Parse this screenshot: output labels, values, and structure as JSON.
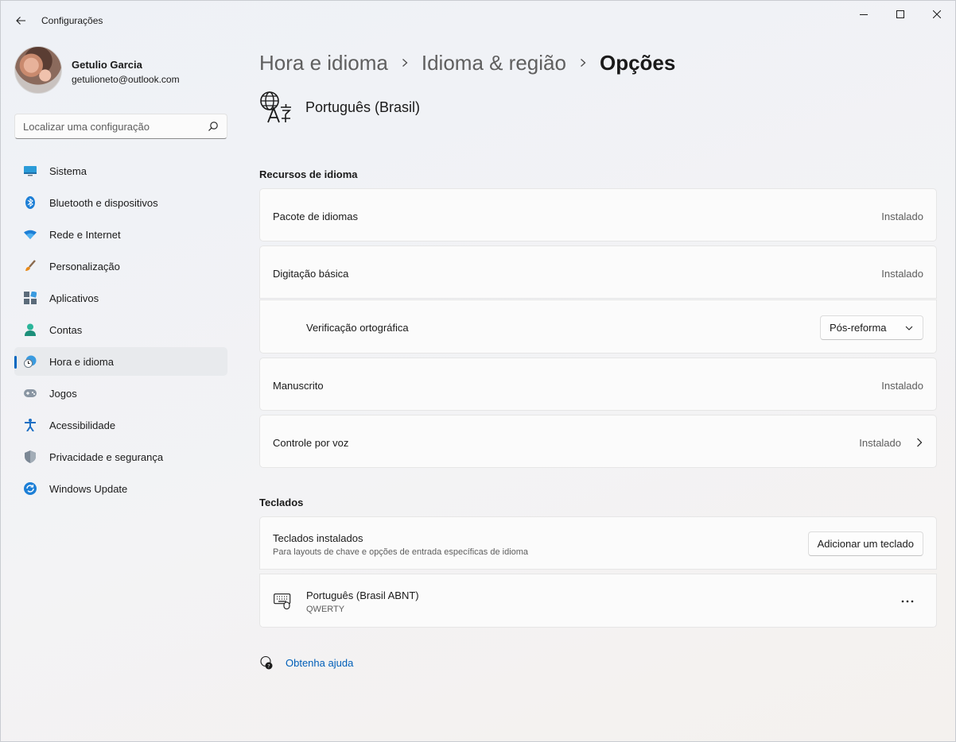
{
  "window": {
    "app_title": "Configurações"
  },
  "profile": {
    "name": "Getulio Garcia",
    "email": "getulioneto@outlook.com"
  },
  "search": {
    "placeholder": "Localizar uma configuração"
  },
  "sidebar": {
    "items": [
      {
        "label": "Sistema",
        "icon": "monitor-icon"
      },
      {
        "label": "Bluetooth e dispositivos",
        "icon": "bluetooth-icon"
      },
      {
        "label": "Rede e Internet",
        "icon": "wifi-icon"
      },
      {
        "label": "Personalização",
        "icon": "brush-icon"
      },
      {
        "label": "Aplicativos",
        "icon": "apps-icon"
      },
      {
        "label": "Contas",
        "icon": "person-icon"
      },
      {
        "label": "Hora e idioma",
        "icon": "clock-globe-icon",
        "active": true
      },
      {
        "label": "Jogos",
        "icon": "gamepad-icon"
      },
      {
        "label": "Acessibilidade",
        "icon": "accessibility-icon"
      },
      {
        "label": "Privacidade e segurança",
        "icon": "shield-icon"
      },
      {
        "label": "Windows Update",
        "icon": "update-icon"
      }
    ]
  },
  "breadcrumb": {
    "items": [
      "Hora e idioma",
      "Idioma & região",
      "Opções"
    ]
  },
  "language": {
    "name": "Português (Brasil)",
    "icon": "language-icon"
  },
  "language_features": {
    "title": "Recursos de idioma",
    "rows": [
      {
        "label": "Pacote de idiomas",
        "status": "Instalado"
      },
      {
        "label": "Digitação básica",
        "status": "Instalado"
      },
      {
        "label": "Verificação ortográfica",
        "value": "Pós-reforma"
      },
      {
        "label": "Manuscrito",
        "status": "Instalado"
      },
      {
        "label": "Controle por voz",
        "status": "Instalado"
      }
    ]
  },
  "keyboards": {
    "title": "Teclados",
    "installed_label": "Teclados instalados",
    "installed_sub": "Para layouts de chave e opções de entrada específicas de idioma",
    "add_button": "Adicionar um teclado",
    "items": [
      {
        "name": "Português (Brasil ABNT)",
        "layout": "QWERTY"
      }
    ]
  },
  "help": {
    "label": "Obtenha ajuda"
  },
  "colors": {
    "accent": "#0067c0",
    "link": "#005fb8"
  }
}
